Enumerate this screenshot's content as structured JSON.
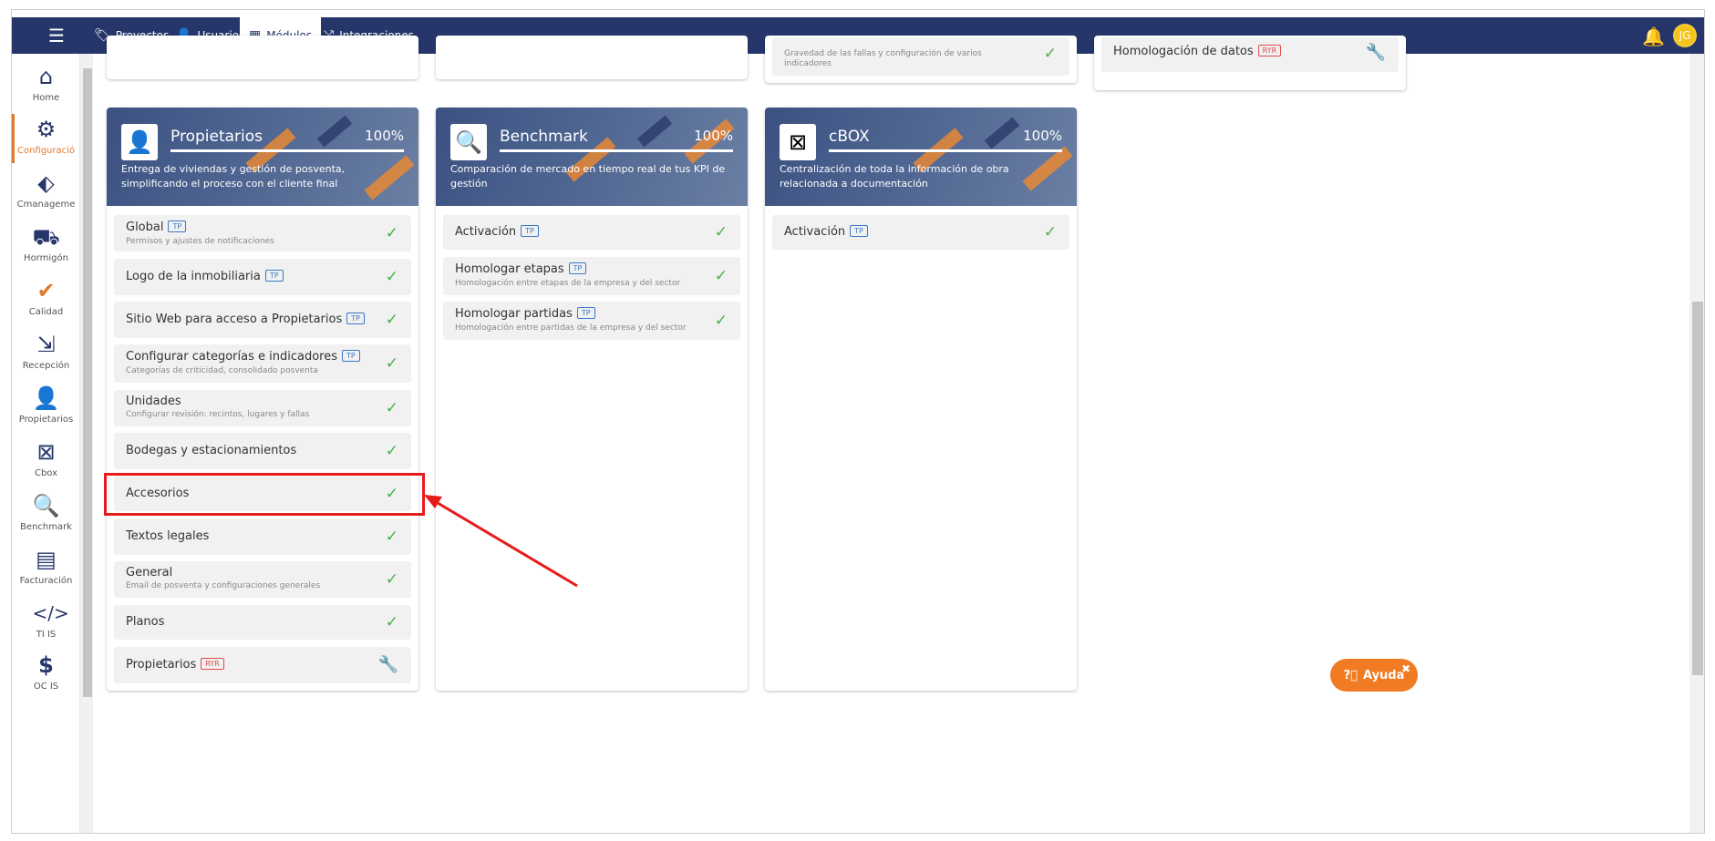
{
  "topnav": {
    "items": [
      {
        "label": "Proyectos",
        "icon": "tags-icon"
      },
      {
        "label": "Usuarios",
        "icon": "user-icon"
      },
      {
        "label": "Módulos",
        "icon": "grid-icon"
      },
      {
        "label": "Integraciones",
        "icon": "shuffle-icon"
      }
    ],
    "avatar_initials": "JG"
  },
  "sidebar": {
    "items": [
      {
        "label": "Home"
      },
      {
        "label": "Configuració"
      },
      {
        "label": "Cmanageme"
      },
      {
        "label": "Hormigón"
      },
      {
        "label": "Calidad"
      },
      {
        "label": "Recepción"
      },
      {
        "label": "Propietarios"
      },
      {
        "label": "Cbox"
      },
      {
        "label": "Benchmark"
      },
      {
        "label": "Facturación"
      },
      {
        "label": "TI IS"
      },
      {
        "label": "OC IS"
      }
    ]
  },
  "top_partial": {
    "row_sub": "Gravedad de las fallas y configuración de varios indicadores",
    "row_title_right": "Homologación de datos",
    "tag_ryr": "RYR"
  },
  "cards": {
    "propietarios": {
      "title": "Propietarios",
      "percent": "100%",
      "description": "Entrega de viviendas y gestión de posventa, simplificando el proceso con el cliente final",
      "rows": [
        {
          "title": "Global",
          "tag": "TP",
          "sub": "Permisos y ajustes de notificaciones"
        },
        {
          "title": "Logo de la inmobiliaria",
          "tag": "TP"
        },
        {
          "title": "Sitio Web para acceso a Propietarios",
          "tag": "TP"
        },
        {
          "title": "Configurar categorías e indicadores",
          "tag": "TP",
          "sub": "Categorías de criticidad, consolidado posventa"
        },
        {
          "title": "Unidades",
          "sub": "Configurar revisión: recintos, lugares y fallas"
        },
        {
          "title": "Bodegas y estacionamientos"
        },
        {
          "title": "Accesorios"
        },
        {
          "title": "Textos legales"
        },
        {
          "title": "General",
          "sub": "Email de posventa y configuraciones generales"
        },
        {
          "title": "Planos"
        },
        {
          "title": "Propietarios",
          "tag": "RYR"
        }
      ]
    },
    "benchmark": {
      "title": "Benchmark",
      "percent": "100%",
      "description": "Comparación de mercado en tiempo real de tus KPI de gestión",
      "rows": [
        {
          "title": "Activación",
          "tag": "TP"
        },
        {
          "title": "Homologar etapas",
          "tag": "TP",
          "sub": "Homologación entre etapas de la empresa y del sector"
        },
        {
          "title": "Homologar partidas",
          "tag": "TP",
          "sub": "Homologación entre partidas de la empresa y del sector"
        }
      ]
    },
    "cbox": {
      "title": "cBOX",
      "percent": "100%",
      "description": "Centralización de toda la información de obra relacionada a documentación",
      "rows": [
        {
          "title": "Activación",
          "tag": "TP"
        }
      ]
    }
  },
  "help": {
    "label": "Ayuda",
    "close": "✖"
  },
  "colors": {
    "nav": "#26366b",
    "accent": "#e07a2e",
    "check": "#48b04b",
    "highlight": "#e81b1b"
  }
}
